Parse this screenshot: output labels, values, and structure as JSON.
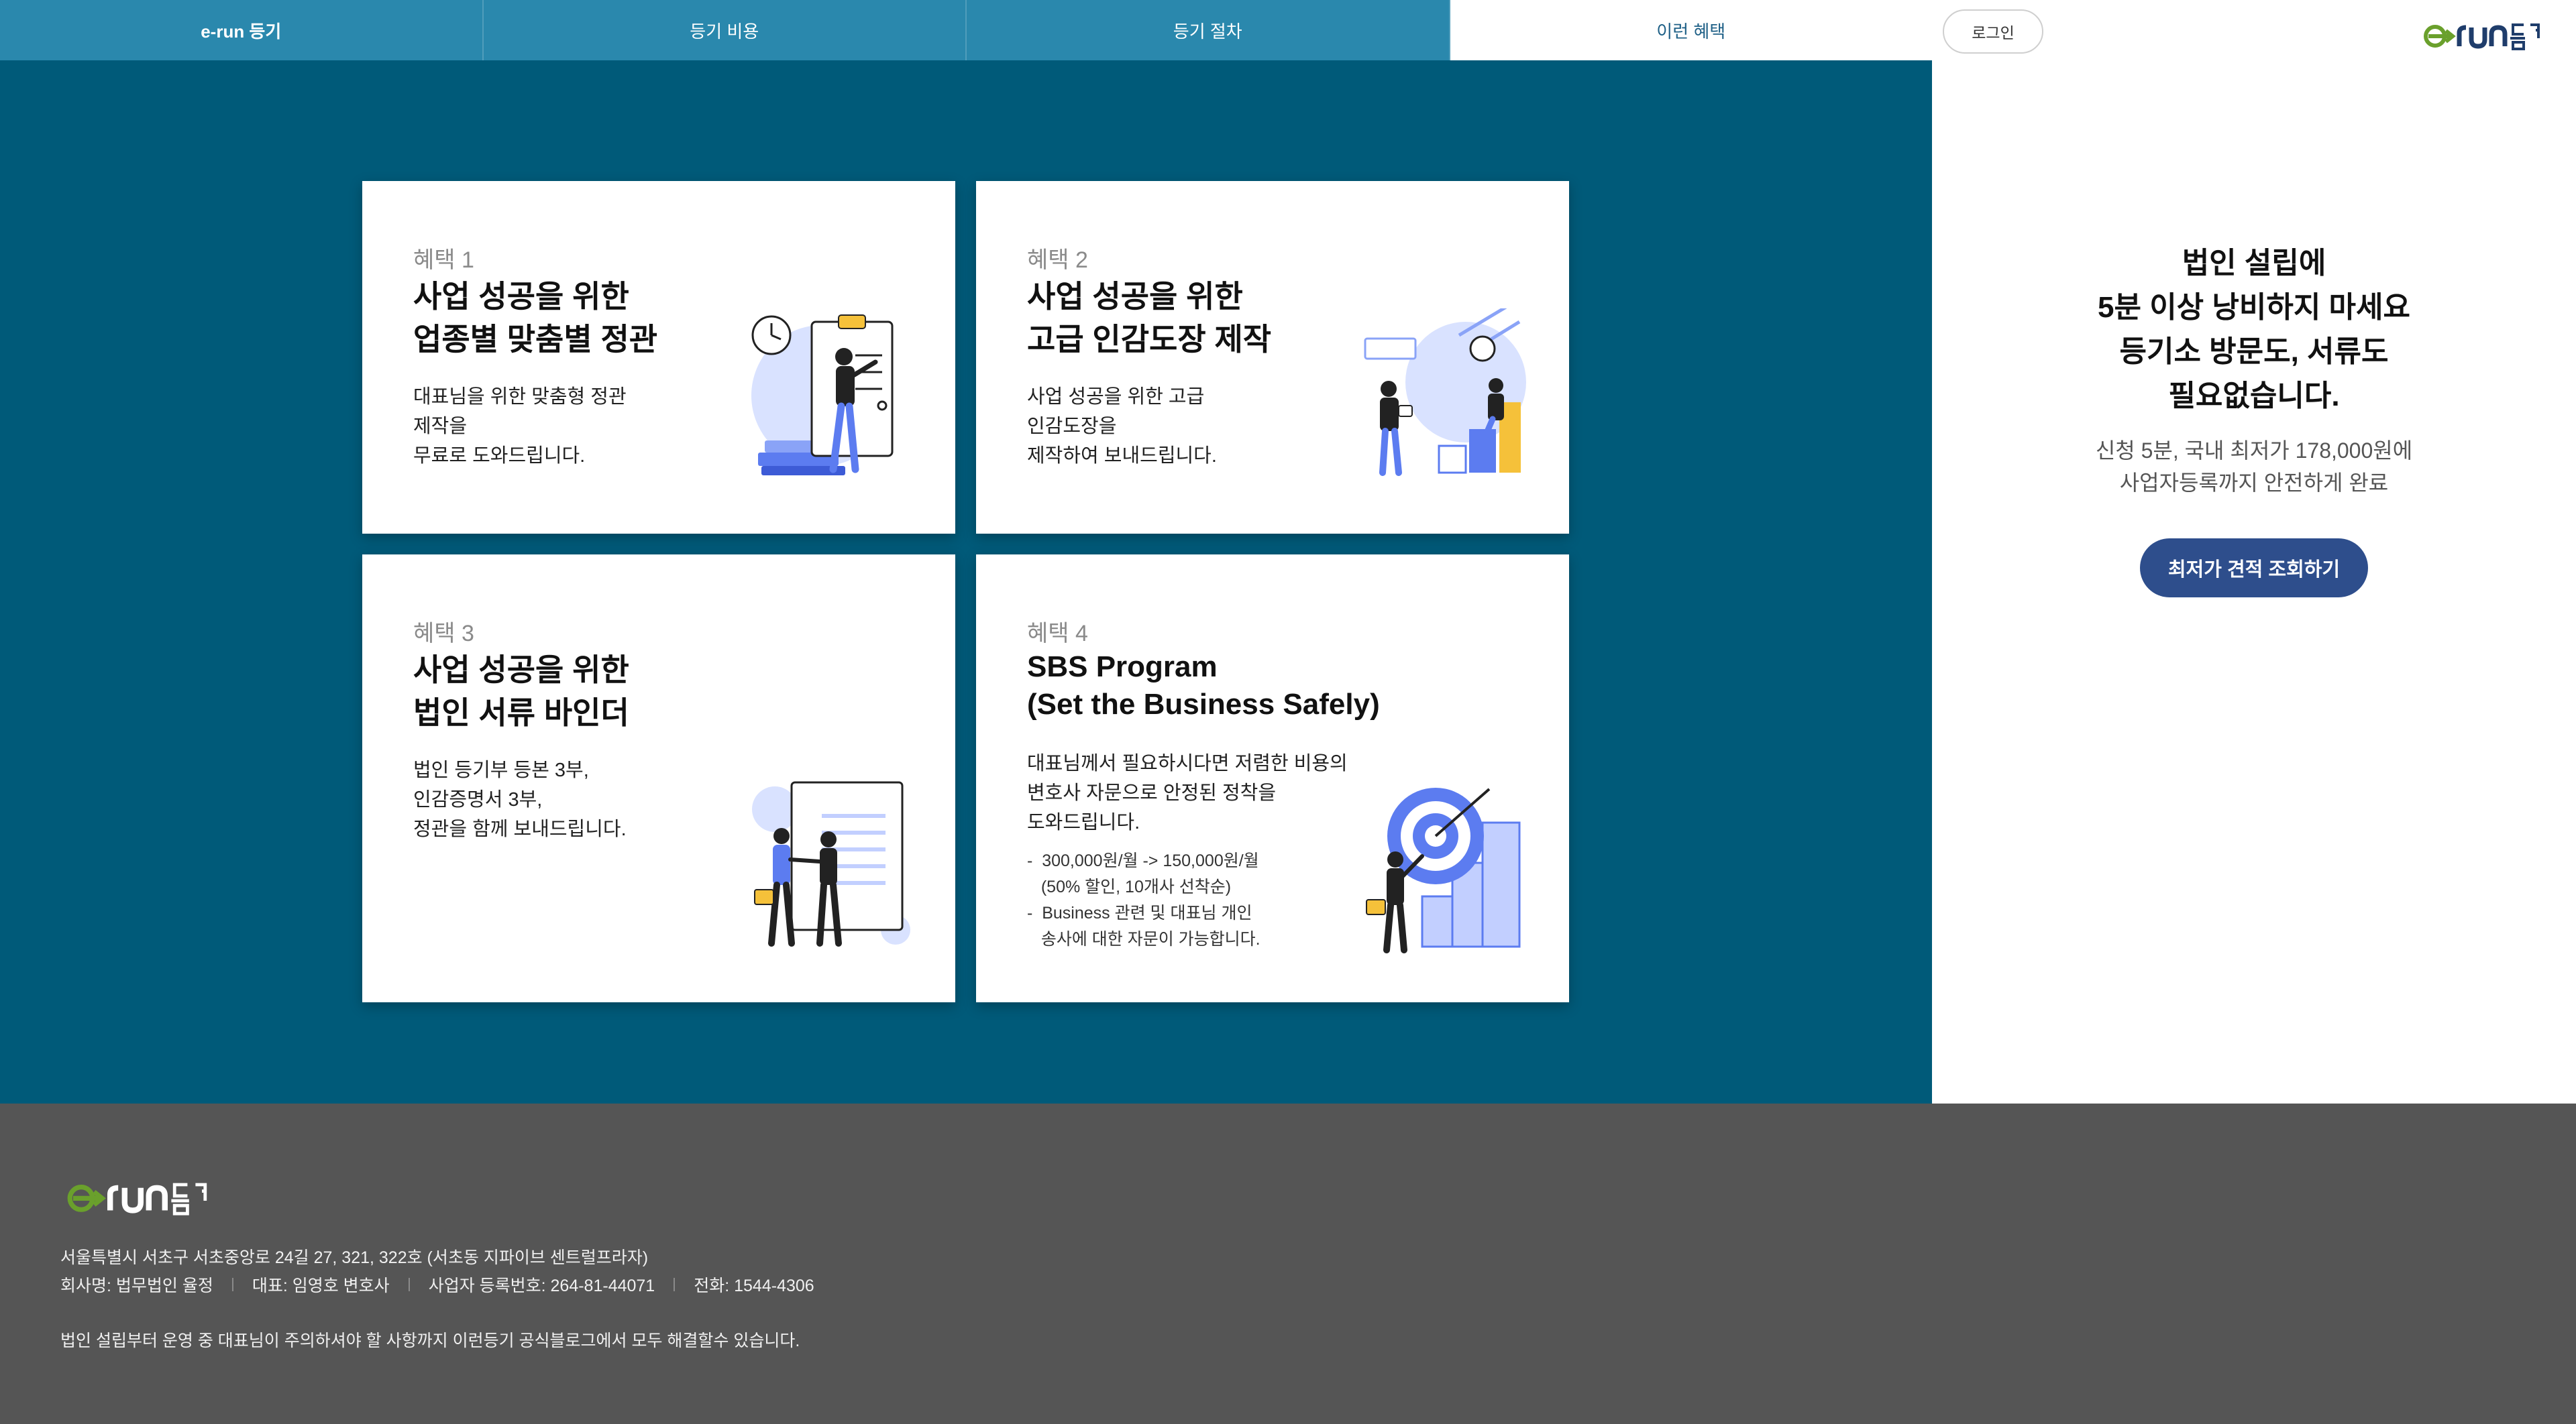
{
  "nav": {
    "tabs": [
      {
        "label": "e-run 등기"
      },
      {
        "label": "등기 비용"
      },
      {
        "label": "등기 절차"
      },
      {
        "label": "이런 혜택"
      }
    ],
    "active_tab": "이런 혜택"
  },
  "benefits": [
    {
      "badge": "혜택 1",
      "title": [
        "사업 성공을 위한",
        "업종별 맞춤별 정관"
      ],
      "desc": [
        "대표님을 위한 맞춤형 정관",
        "제작을",
        "무료로 도와드립니다."
      ]
    },
    {
      "badge": "혜택 2",
      "title": [
        "사업 성공을 위한",
        "고급 인감도장 제작"
      ],
      "desc": [
        "사업 성공을 위한 고급",
        "인감도장을",
        "제작하여 보내드립니다."
      ]
    },
    {
      "badge": "혜택 3",
      "title": [
        "사업 성공을 위한",
        "법인 서류 바인더"
      ],
      "desc": [
        "법인 등기부 등본 3부,",
        "인감증명서 3부,",
        "정관을 함께 보내드립니다."
      ]
    },
    {
      "badge": "혜택 4",
      "title": [
        "SBS Program",
        "(Set the Business Safely)"
      ],
      "desc": [
        "대표님께서 필요하시다면 저렴한 비용의",
        "변호사 자문으로 안정된 정착을",
        "도와드립니다."
      ],
      "bullets": [
        "-  300,000원/월 -> 150,000원/월",
        "   (50% 할인, 10개사 선착순)",
        "-  Business 관련 및 대표님 개인",
        "   송사에 대한 자문이 가능합니다."
      ]
    }
  ],
  "sidebar": {
    "login_label": "로그인",
    "logo_text": "e-run 등기",
    "headline": [
      "법인 설립에",
      "5분 이상 낭비하지 마세요",
      "등기소 방문도, 서류도",
      "필요없습니다."
    ],
    "subtext": [
      "신청 5분, 국내 최저가 178,000원에",
      "사업자등록까지 안전하게 완료"
    ],
    "cta_label": "최저가 견적 조회하기"
  },
  "footer": {
    "logo_text": "e-run 등기",
    "address": "서울특별시 서초구 서초중앙로 24길 27, 321, 322호 (서초동 지파이브 센트럴프라자)",
    "company": "회사명: 법무법인 율정",
    "ceo": "대표: 임영호 변호사",
    "biz_no": "사업자 등록번호: 264-81-44071",
    "phone": "전화: 1544-4306",
    "blog_text": "법인 설립부터 운영 중 대표님이 주의하셔야 할 사항까지 이런등기 공식블로그에서 모두 해결할수 있습니다."
  },
  "colors": {
    "nav_bg": "#2a88ad",
    "main_bg": "#005a79",
    "cta_bg": "#2e4e8c",
    "footer_bg": "#555555",
    "logo_green": "#6aa02c",
    "logo_navy": "#1f3d6b",
    "illustration_blue": "#5c7cf0",
    "illustration_yellow": "#f5c13a"
  }
}
